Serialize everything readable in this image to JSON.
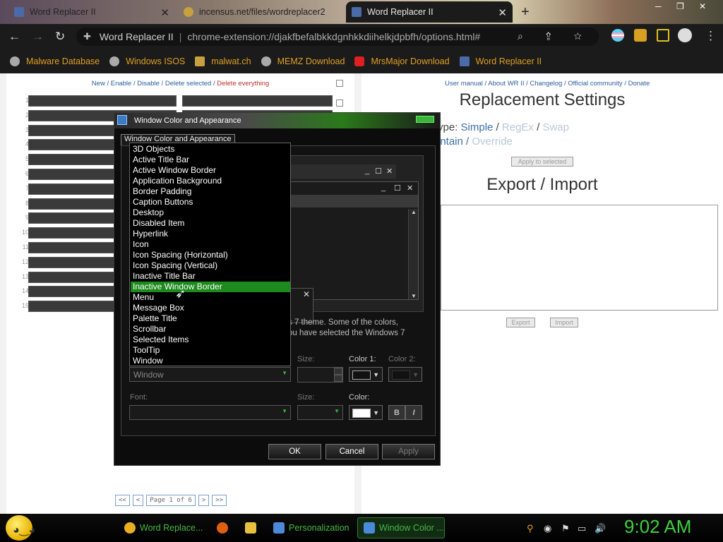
{
  "browser": {
    "tabs": [
      {
        "label": "Word Replacer II",
        "favicon_color": "#4a6aa8"
      },
      {
        "label": "incensus.net/files/wordreplacer2",
        "favicon_color": "#c8a040"
      },
      {
        "label": "Word Replacer II",
        "favicon_color": "#4a6aa8"
      }
    ],
    "new_tab_label": "+",
    "window_controls": [
      "─",
      "❐",
      "✕"
    ],
    "nav": {
      "back": "←",
      "forward": "→",
      "reload": "↻"
    },
    "omnibox": {
      "page_name": "Word Replacer II",
      "separator": "|",
      "url": "chrome-extension://djakfbefalbkkdgnhkkdiihelkjdpbfh/options.html#",
      "tools": "⌕ ⇪ ☆"
    },
    "extension_icons": [
      "extension-trans-flag-icon",
      "puzzle-icon",
      "sidepanel-icon",
      "profile-icon",
      "menu-dots-icon"
    ],
    "menu_label": "⋮",
    "bookmarks": [
      {
        "label": "Malware Database",
        "icon_color": "#aaaaaa"
      },
      {
        "label": "Windows ISOS",
        "icon_color": "#aaaaaa"
      },
      {
        "label": "malwat.ch",
        "icon_color": "#c8a040"
      },
      {
        "label": "MEMZ Download",
        "icon_color": "#aaaaaa"
      },
      {
        "label": "MrsMajor Download",
        "icon_color": "#e02020"
      },
      {
        "label": "Word Replacer II",
        "icon_color": "#4a6aa8"
      }
    ]
  },
  "left": {
    "links": {
      "new": "New",
      "sep": " / ",
      "enable": "Enable",
      "disable": "Disable",
      "delete_selected": "Delete selected",
      "delete_everything": "Delete everything"
    },
    "row_numbers": [
      "1",
      "2",
      "3",
      "4",
      "5",
      "6",
      "7",
      "8",
      "9",
      "10",
      "11",
      "12",
      "13",
      "14",
      "15"
    ],
    "pager": {
      "first": "<<",
      "prev": "<",
      "page": "Page 1 of 6",
      "next": ">",
      "last": ">>"
    }
  },
  "right": {
    "links": "User manual / About WR II / Changelog / Official community / Donate",
    "title": "Replacement Settings",
    "type_prefix": "ype: ",
    "type_simple": "Simple",
    "type_regex": "RegEx",
    "type_swap": "Swap",
    "slash": " / ",
    "maintain": "intain",
    "override": "Override",
    "apply_selected": "Apply to selected",
    "export_title": "Export / Import",
    "export_btn": "Export",
    "import_btn": "Import"
  },
  "dialog": {
    "title": "Window Color and Appearance",
    "tab": "Window Color and Appearance",
    "desc": "s 7 theme.  Some of the colors,\nou have selected the Windows 7",
    "labels": {
      "size": "Size:",
      "color1": "Color 1:",
      "color2": "Color 2:",
      "font": "Font:",
      "size2": "Size:",
      "color": "Color:"
    },
    "item_value": "Window",
    "bold": "B",
    "italic": "I",
    "ok": "OK",
    "cancel": "Cancel",
    "apply": "Apply",
    "dropdown_items": [
      "3D Objects",
      "Active Title Bar",
      "Active Window Border",
      "Application Background",
      "Border Padding",
      "Caption Buttons",
      "Desktop",
      "Disabled Item",
      "Hyperlink",
      "Icon",
      "Icon Spacing (Horizontal)",
      "Icon Spacing (Vertical)",
      "Inactive Title Bar",
      "Inactive Window Border",
      "Menu",
      "Message Box",
      "Palette Title",
      "Scrollbar",
      "Selected Items",
      "ToolTip",
      "Window"
    ],
    "selected_item": "Inactive Window Border"
  },
  "taskbar": {
    "tasks": [
      {
        "label": "Word Replace...",
        "icon_color": "#e8b020"
      },
      {
        "label": "",
        "icon_color": "#e06010"
      },
      {
        "label": "",
        "icon_color": "#e8c040"
      },
      {
        "label": "Personalization",
        "icon_color": "#4a8ad8"
      },
      {
        "label": "Window Color ...",
        "icon_color": "#4a8ad8"
      }
    ],
    "tray": [
      "⚲",
      "◉",
      "⚑",
      "▭",
      "🔊"
    ],
    "clock": "9:02 AM",
    "accent": "#3cd03c"
  }
}
